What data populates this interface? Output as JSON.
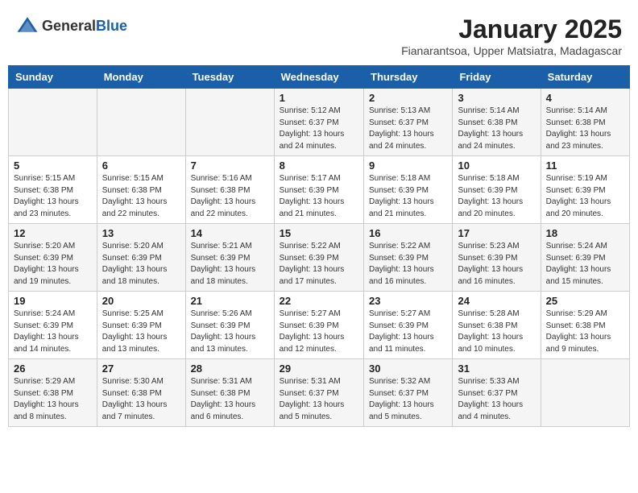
{
  "header": {
    "logo_general": "General",
    "logo_blue": "Blue",
    "title": "January 2025",
    "subtitle": "Fianarantsoa, Upper Matsiatra, Madagascar"
  },
  "weekdays": [
    "Sunday",
    "Monday",
    "Tuesday",
    "Wednesday",
    "Thursday",
    "Friday",
    "Saturday"
  ],
  "weeks": [
    [
      {
        "day": "",
        "info": ""
      },
      {
        "day": "",
        "info": ""
      },
      {
        "day": "",
        "info": ""
      },
      {
        "day": "1",
        "info": "Sunrise: 5:12 AM\nSunset: 6:37 PM\nDaylight: 13 hours\nand 24 minutes."
      },
      {
        "day": "2",
        "info": "Sunrise: 5:13 AM\nSunset: 6:37 PM\nDaylight: 13 hours\nand 24 minutes."
      },
      {
        "day": "3",
        "info": "Sunrise: 5:14 AM\nSunset: 6:38 PM\nDaylight: 13 hours\nand 24 minutes."
      },
      {
        "day": "4",
        "info": "Sunrise: 5:14 AM\nSunset: 6:38 PM\nDaylight: 13 hours\nand 23 minutes."
      }
    ],
    [
      {
        "day": "5",
        "info": "Sunrise: 5:15 AM\nSunset: 6:38 PM\nDaylight: 13 hours\nand 23 minutes."
      },
      {
        "day": "6",
        "info": "Sunrise: 5:15 AM\nSunset: 6:38 PM\nDaylight: 13 hours\nand 22 minutes."
      },
      {
        "day": "7",
        "info": "Sunrise: 5:16 AM\nSunset: 6:38 PM\nDaylight: 13 hours\nand 22 minutes."
      },
      {
        "day": "8",
        "info": "Sunrise: 5:17 AM\nSunset: 6:39 PM\nDaylight: 13 hours\nand 21 minutes."
      },
      {
        "day": "9",
        "info": "Sunrise: 5:18 AM\nSunset: 6:39 PM\nDaylight: 13 hours\nand 21 minutes."
      },
      {
        "day": "10",
        "info": "Sunrise: 5:18 AM\nSunset: 6:39 PM\nDaylight: 13 hours\nand 20 minutes."
      },
      {
        "day": "11",
        "info": "Sunrise: 5:19 AM\nSunset: 6:39 PM\nDaylight: 13 hours\nand 20 minutes."
      }
    ],
    [
      {
        "day": "12",
        "info": "Sunrise: 5:20 AM\nSunset: 6:39 PM\nDaylight: 13 hours\nand 19 minutes."
      },
      {
        "day": "13",
        "info": "Sunrise: 5:20 AM\nSunset: 6:39 PM\nDaylight: 13 hours\nand 18 minutes."
      },
      {
        "day": "14",
        "info": "Sunrise: 5:21 AM\nSunset: 6:39 PM\nDaylight: 13 hours\nand 18 minutes."
      },
      {
        "day": "15",
        "info": "Sunrise: 5:22 AM\nSunset: 6:39 PM\nDaylight: 13 hours\nand 17 minutes."
      },
      {
        "day": "16",
        "info": "Sunrise: 5:22 AM\nSunset: 6:39 PM\nDaylight: 13 hours\nand 16 minutes."
      },
      {
        "day": "17",
        "info": "Sunrise: 5:23 AM\nSunset: 6:39 PM\nDaylight: 13 hours\nand 16 minutes."
      },
      {
        "day": "18",
        "info": "Sunrise: 5:24 AM\nSunset: 6:39 PM\nDaylight: 13 hours\nand 15 minutes."
      }
    ],
    [
      {
        "day": "19",
        "info": "Sunrise: 5:24 AM\nSunset: 6:39 PM\nDaylight: 13 hours\nand 14 minutes."
      },
      {
        "day": "20",
        "info": "Sunrise: 5:25 AM\nSunset: 6:39 PM\nDaylight: 13 hours\nand 13 minutes."
      },
      {
        "day": "21",
        "info": "Sunrise: 5:26 AM\nSunset: 6:39 PM\nDaylight: 13 hours\nand 13 minutes."
      },
      {
        "day": "22",
        "info": "Sunrise: 5:27 AM\nSunset: 6:39 PM\nDaylight: 13 hours\nand 12 minutes."
      },
      {
        "day": "23",
        "info": "Sunrise: 5:27 AM\nSunset: 6:39 PM\nDaylight: 13 hours\nand 11 minutes."
      },
      {
        "day": "24",
        "info": "Sunrise: 5:28 AM\nSunset: 6:38 PM\nDaylight: 13 hours\nand 10 minutes."
      },
      {
        "day": "25",
        "info": "Sunrise: 5:29 AM\nSunset: 6:38 PM\nDaylight: 13 hours\nand 9 minutes."
      }
    ],
    [
      {
        "day": "26",
        "info": "Sunrise: 5:29 AM\nSunset: 6:38 PM\nDaylight: 13 hours\nand 8 minutes."
      },
      {
        "day": "27",
        "info": "Sunrise: 5:30 AM\nSunset: 6:38 PM\nDaylight: 13 hours\nand 7 minutes."
      },
      {
        "day": "28",
        "info": "Sunrise: 5:31 AM\nSunset: 6:38 PM\nDaylight: 13 hours\nand 6 minutes."
      },
      {
        "day": "29",
        "info": "Sunrise: 5:31 AM\nSunset: 6:37 PM\nDaylight: 13 hours\nand 5 minutes."
      },
      {
        "day": "30",
        "info": "Sunrise: 5:32 AM\nSunset: 6:37 PM\nDaylight: 13 hours\nand 5 minutes."
      },
      {
        "day": "31",
        "info": "Sunrise: 5:33 AM\nSunset: 6:37 PM\nDaylight: 13 hours\nand 4 minutes."
      },
      {
        "day": "",
        "info": ""
      }
    ]
  ]
}
